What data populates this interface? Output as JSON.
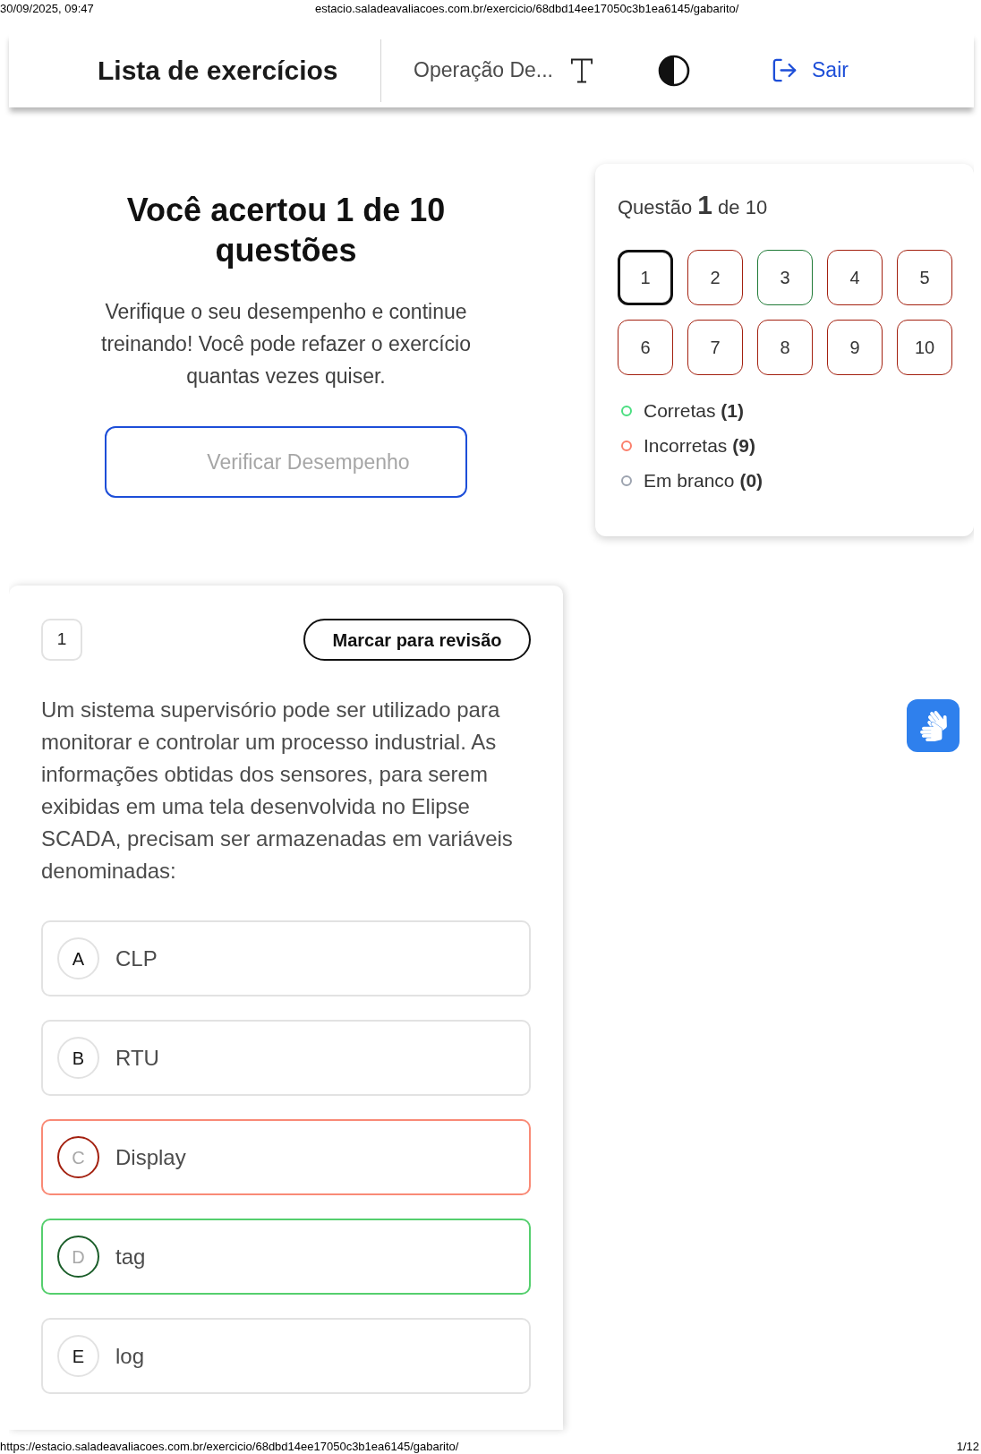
{
  "print_header": {
    "datetime": "30/09/2025, 09:47",
    "url": "estacio.saladeavaliacoes.com.br/exercicio/68dbd14ee17050c3b1ea6145/gabarito/"
  },
  "header": {
    "title": "Lista de exercícios",
    "subject": "Operação De...",
    "logout": "Sair"
  },
  "result": {
    "title": "Você acertou 1 de 10 questões",
    "message": "Verifique o seu desempenho e continue treinando! Você pode refazer o exercício quantas vezes quiser.",
    "button": "Verificar Desempenho"
  },
  "navigator": {
    "heading": "Questão **1** de 10",
    "questions": [
      {
        "label": "1",
        "selected": true
      },
      {
        "label": "2",
        "selected": false,
        "correct": false
      },
      {
        "label": "3",
        "selected": false,
        "correct": true
      },
      {
        "label": "4",
        "selected": false,
        "correct": false
      },
      {
        "label": "5",
        "selected": false,
        "correct": false
      },
      {
        "label": "6",
        "selected": false,
        "correct": false
      },
      {
        "label": "7",
        "selected": false,
        "correct": false
      },
      {
        "label": "8",
        "selected": false,
        "correct": false
      },
      {
        "label": "9",
        "selected": false,
        "correct": false
      },
      {
        "label": "10",
        "selected": false,
        "correct": false
      }
    ],
    "legend": [
      {
        "label": "Corretas **(1)**",
        "color": "#4ade80"
      },
      {
        "label": "Incorretas **(9)**",
        "color": "#fb7f6b"
      },
      {
        "label": "Em branco **(0)**",
        "color": "#9ca3af"
      }
    ]
  },
  "question": {
    "number": "1",
    "review_button": "Marcar para revisão",
    "text": "Um sistema supervisório pode ser utilizado para monitorar e controlar um processo industrial. As informações obtidas dos sensores, para serem exibidas em uma tela desenvolvida no Elipse SCADA, precisam ser armazenadas em variáveis denominadas:",
    "options": [
      {
        "kind": "plain",
        "letter": "A",
        "text": "CLP"
      },
      {
        "kind": "plain",
        "letter": "B",
        "text": "RTU"
      },
      {
        "kind": "wrong",
        "letter": "C",
        "text": "Display"
      },
      {
        "kind": "right",
        "letter": "D",
        "text": "tag"
      },
      {
        "kind": "plain",
        "letter": "E",
        "text": "log"
      }
    ]
  },
  "print_footer": {
    "url": "https://estacio.saladeavaliacoes.com.br/exercicio/68dbd14ee17050c3b1ea6145/gabarito/",
    "page": "1/12"
  }
}
